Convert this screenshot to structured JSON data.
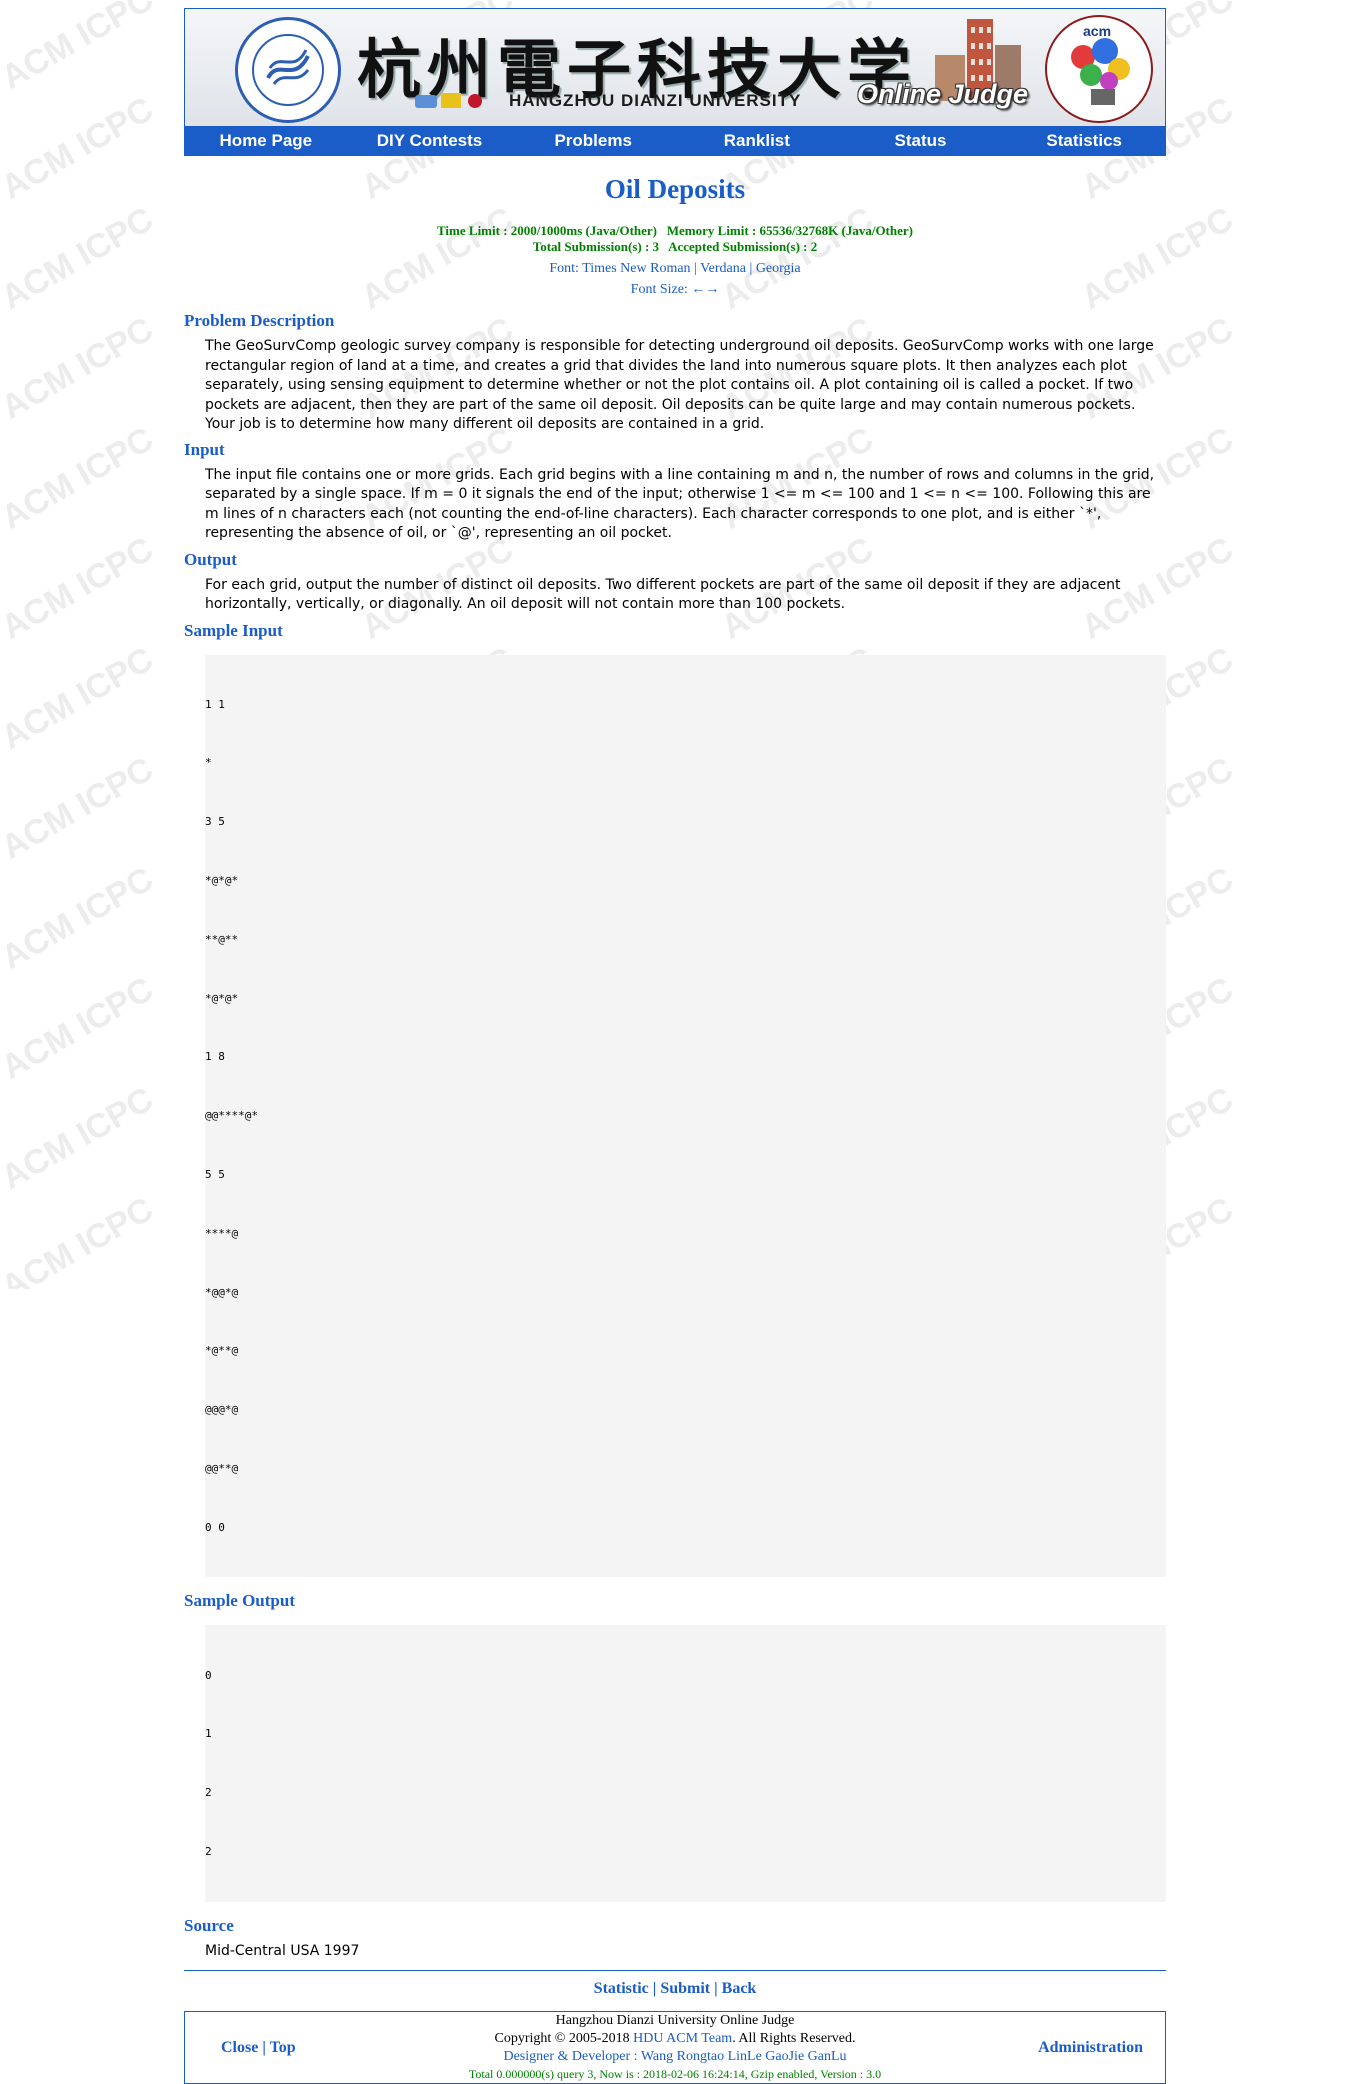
{
  "watermark": {
    "text": "ACM ICPC"
  },
  "banner": {
    "cn_title": "杭州電子科技大学",
    "en_title": "HANGZHOU DIANZI UNIVERSITY",
    "oj_title": "Online Judge",
    "acm_logo_text": "acm",
    "seal_icon": "university-seal-icon",
    "acm_icon": "acm-icpc-logo-icon"
  },
  "nav": {
    "items": [
      {
        "label": "Home Page"
      },
      {
        "label": "DIY Contests"
      },
      {
        "label": "Problems"
      },
      {
        "label": "Ranklist"
      },
      {
        "label": "Status"
      },
      {
        "label": "Statistics"
      }
    ]
  },
  "problem": {
    "title": "Oil Deposits",
    "limits_line1": "Time Limit : 2000/1000ms (Java/Other)   Memory Limit : 65536/32768K (Java/Other)",
    "limits_line2": "Total Submission(s) : 3   Accepted Submission(s) : 2",
    "font_label": "Font:",
    "font_options": [
      "Times New Roman",
      "Verdana",
      "Georgia"
    ],
    "font_size_label": "Font Size:",
    "font_size_arrows": [
      "←",
      "→"
    ]
  },
  "sections": {
    "description_title": "Problem Description",
    "description": "The GeoSurvComp geologic survey company is responsible for detecting underground oil deposits. GeoSurvComp works with one large rectangular region of land at a time, and creates a grid that divides the land into numerous square plots. It then analyzes each plot separately, using sensing equipment to determine whether or not the plot contains oil. A plot containing oil is called a pocket. If two pockets are adjacent, then they are part of the same oil deposit. Oil deposits can be quite large and may contain numerous pockets. Your job is to determine how many different oil deposits are contained in a grid.",
    "input_title": "Input",
    "input": "The input file contains one or more grids. Each grid begins with a line containing m and n, the number of rows and columns in the grid, separated by a single space. If m = 0 it signals the end of the input; otherwise 1 <= m <= 100 and 1 <= n <= 100. Following this are m lines of n characters each (not counting the end-of-line characters). Each character corresponds to one plot, and is either `*', representing the absence of oil, or `@', representing an oil pocket.",
    "output_title": "Output",
    "output": "For each grid, output the number of distinct oil deposits. Two different pockets are part of the same oil deposit if they are adjacent horizontally, vertically, or diagonally. An oil deposit will not contain more than 100 pockets.",
    "sample_input_title": "Sample Input",
    "sample_input": [
      "1 1",
      "*",
      "3 5",
      "*@*@*",
      "**@**",
      "*@*@*",
      "1 8",
      "@@****@*",
      "5 5",
      "****@",
      "*@@*@",
      "*@**@",
      "@@@*@",
      "@@**@",
      "0 0"
    ],
    "sample_output_title": "Sample Output",
    "sample_output": [
      "0",
      "1",
      "2",
      "2"
    ],
    "source_title": "Source",
    "source": "Mid-Central USA 1997"
  },
  "bottom_links": {
    "statistic": "Statistic",
    "submit": "Submit",
    "back": "Back",
    "sep": "|"
  },
  "footer": {
    "close": "Close",
    "top": "Top",
    "sep": "|",
    "admin": "Administration",
    "line1": "Hangzhou Dianzi University Online Judge",
    "copyright_prefix": "Copyright © 2005-2018 ",
    "copyright_link": "HDU ACM Team",
    "copyright_suffix": ". All Rights Reserved.",
    "designer_label": "Designer & Developer : ",
    "designer_names": "Wang Rongtao LinLe GaoJie GanLu",
    "status_line": "Total 0.000000(s) query 3, Now is : 2018-02-06 16:24:14, Gzip enabled, Version : 3.0"
  },
  "colors": {
    "brand_blue": "#1a5cc8",
    "green": "#008000",
    "sample_bg": "#f4f4f4"
  }
}
